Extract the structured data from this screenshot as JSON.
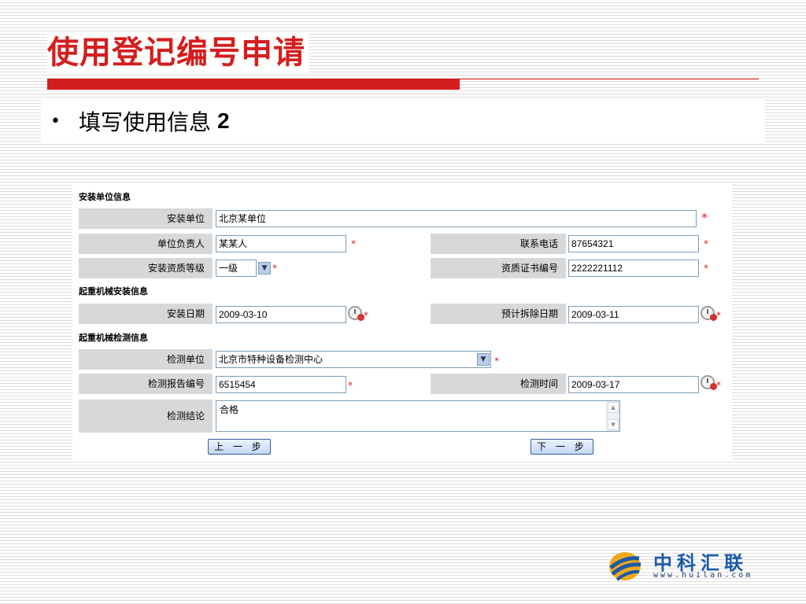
{
  "slide": {
    "title": "使用登记编号申请",
    "bullet_symbol": "•",
    "bullet_text": "填写使用信息",
    "bullet_num": "2"
  },
  "form": {
    "section1": "安装单位信息",
    "section2": "起重机械安装信息",
    "section3": "起重机械检测信息",
    "required_mark": "*",
    "install_unit": {
      "label": "安装单位",
      "value": "北京某单位"
    },
    "unit_head": {
      "label": "单位负责人",
      "value": "某某人"
    },
    "phone": {
      "label": "联系电话",
      "value": "87654321"
    },
    "qual_level": {
      "label": "安装资质等级",
      "value": "一级"
    },
    "cert_no": {
      "label": "资质证书编号",
      "value": "2222221112"
    },
    "install_date": {
      "label": "安装日期",
      "value": "2009-03-10"
    },
    "removal_date": {
      "label": "预计拆除日期",
      "value": "2009-03-11"
    },
    "test_unit": {
      "label": "检测单位",
      "value": "北京市特种设备检测中心"
    },
    "report_no": {
      "label": "检测报告编号",
      "value": "6515454"
    },
    "test_time": {
      "label": "检测时间",
      "value": "2009-03-17"
    },
    "conclusion": {
      "label": "检测结论",
      "value": "合格"
    },
    "prev_button": "上 一 步",
    "next_button": "下 一 步"
  },
  "logo": {
    "name": "中科汇联",
    "url": "www.huilan.com"
  },
  "colors": {
    "title_red": "#d41e1e",
    "label_gray": "#d8d8d8",
    "logo_blue": "#1b5aa8"
  }
}
